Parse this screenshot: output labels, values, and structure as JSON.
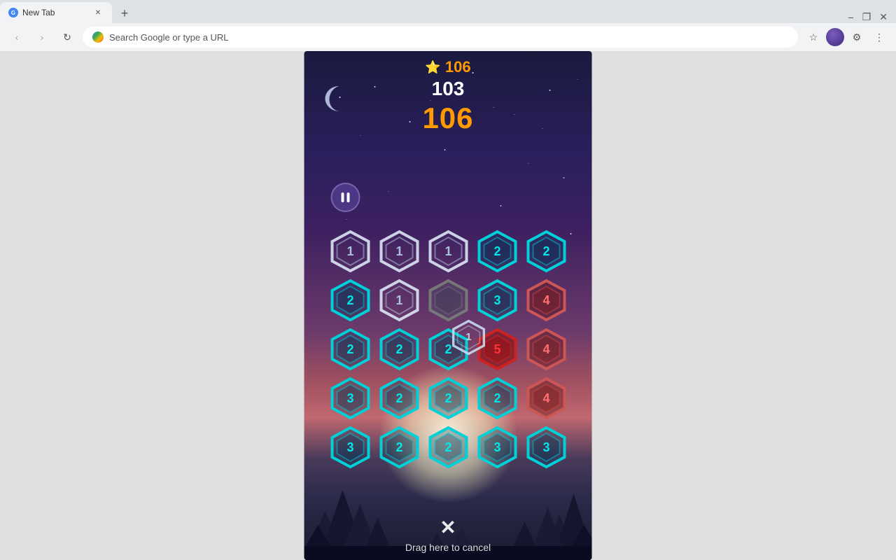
{
  "browser": {
    "tab_title": "New Tab",
    "new_tab_label": "+",
    "address": "Search Google or type a URL",
    "window_controls": {
      "minimize": "−",
      "maximize": "❐",
      "close": "✕"
    }
  },
  "game": {
    "top_score": "106",
    "current_score_display": "103",
    "big_score": "106",
    "cancel_text": "Drag here to cancel",
    "cancel_symbol": "✕",
    "grid": [
      [
        {
          "color": "white",
          "value": "1"
        },
        {
          "color": "white",
          "value": "1"
        },
        {
          "color": "white",
          "value": "1"
        },
        {
          "color": "cyan",
          "value": "2"
        },
        {
          "color": "cyan",
          "value": "2"
        }
      ],
      [
        {
          "color": "cyan",
          "value": "2"
        },
        {
          "color": "white",
          "value": "1"
        },
        {
          "color": "gray",
          "value": ""
        },
        {
          "color": "cyan",
          "value": "3"
        },
        {
          "color": "red",
          "value": "4"
        }
      ],
      [
        {
          "color": "cyan",
          "value": "2"
        },
        {
          "color": "cyan",
          "value": "2"
        },
        {
          "color": "cyan",
          "value": "2"
        },
        {
          "color": "darkred",
          "value": "5"
        },
        {
          "color": "red",
          "value": "4"
        }
      ],
      [
        {
          "color": "cyan",
          "value": "3"
        },
        {
          "color": "cyan",
          "value": "2"
        },
        {
          "color": "cyan",
          "value": "2"
        },
        {
          "color": "cyan",
          "value": "2"
        },
        {
          "color": "red",
          "value": "4"
        }
      ],
      [
        {
          "color": "cyan",
          "value": "3"
        },
        {
          "color": "cyan",
          "value": "2"
        },
        {
          "color": "cyan",
          "value": "2"
        },
        {
          "color": "cyan",
          "value": "3"
        },
        {
          "color": "cyan",
          "value": "3"
        }
      ]
    ]
  }
}
